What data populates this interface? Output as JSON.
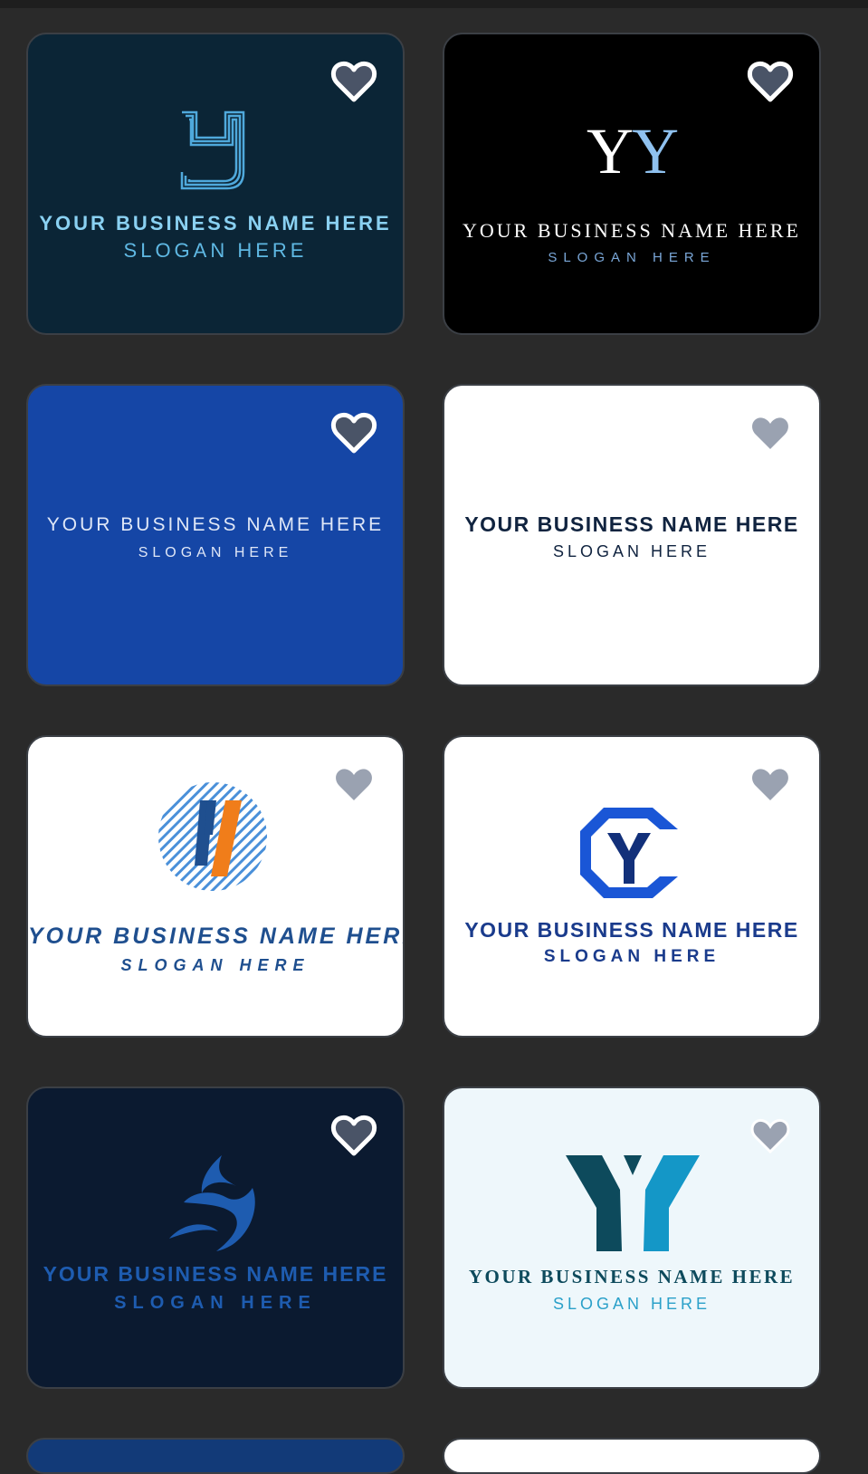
{
  "cards": [
    {
      "name": "YOUR BUSINESS NAME HERE",
      "slogan": "SLOGAN HERE",
      "background": "#0b2536",
      "icon": "heart-outline-icon"
    },
    {
      "monogram": "YY",
      "name": "YOUR BUSINESS NAME HERE",
      "slogan": "SLOGAN HERE",
      "background": "#000000",
      "icon": "heart-outline-icon"
    },
    {
      "name": "YOUR BUSINESS NAME HERE",
      "slogan": "SLOGAN HERE",
      "background": "#1546a6",
      "icon": "heart-outline-icon"
    },
    {
      "name": "YOUR BUSINESS NAME HERE",
      "slogan": "SLOGAN HERE",
      "background": "#ffffff",
      "icon": "heart-filled-icon"
    },
    {
      "name": "YOUR BUSINESS NAME HERE",
      "slogan": "SLOGAN HERE",
      "background": "#ffffff",
      "icon": "heart-filled-icon"
    },
    {
      "name": "YOUR BUSINESS NAME HERE",
      "slogan": "SLOGAN HERE",
      "background": "#ffffff",
      "icon": "heart-filled-icon"
    },
    {
      "name": "YOUR BUSINESS NAME HERE",
      "slogan": "SLOGAN HERE",
      "background": "#0b1a30",
      "icon": "heart-outline-icon"
    },
    {
      "name": "YOUR BUSINESS NAME HERE",
      "slogan": "SLOGAN HERE",
      "background": "#eef7fb",
      "icon": "heart-filled-icon"
    }
  ],
  "colors": {
    "page_background": "#2a2a2a",
    "heart_outline": "#ffffff",
    "heart_fill_dark": "#4a5467",
    "heart_fill_light": "#9aa2b1"
  }
}
